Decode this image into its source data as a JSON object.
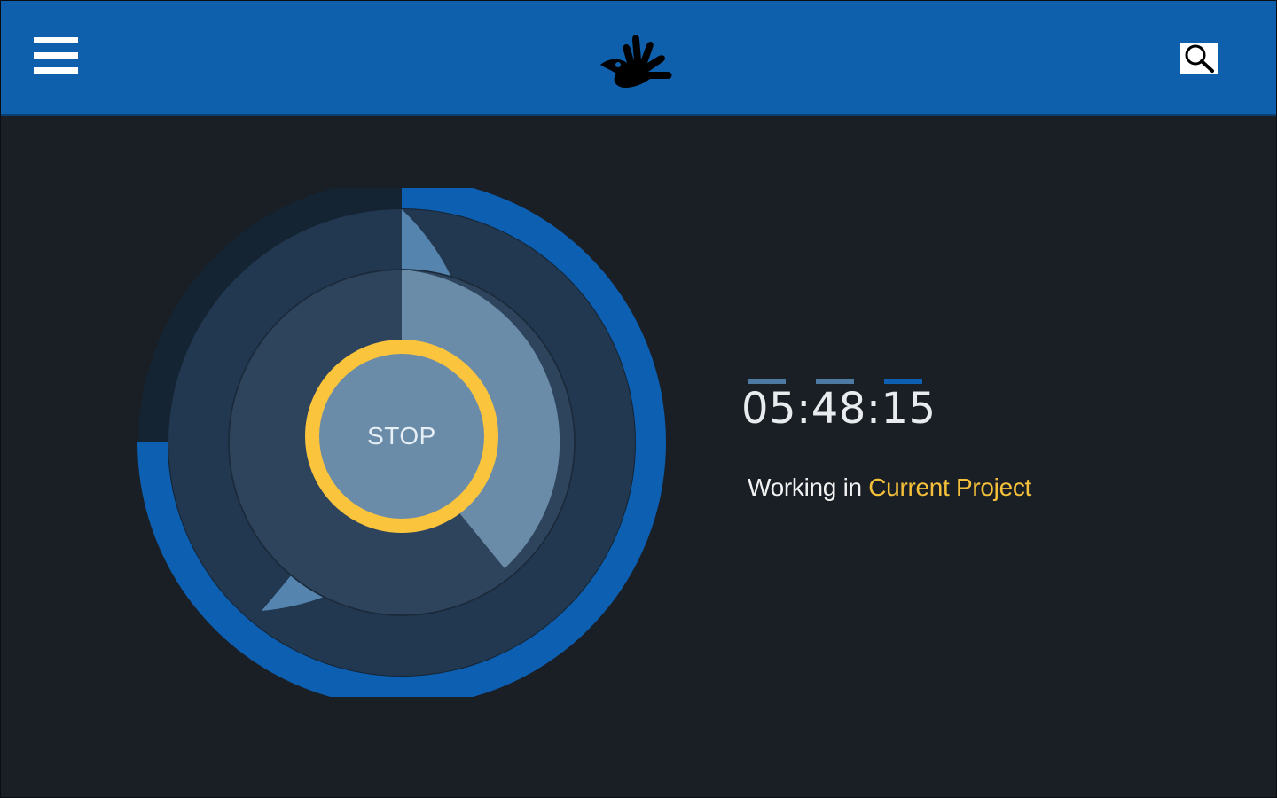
{
  "header": {
    "menu_icon": "hamburger-menu-icon",
    "logo_icon": "accessibility-hand-logo",
    "search_icon": "search-icon",
    "color": "#0e60ad"
  },
  "dial": {
    "button_label": "STOP",
    "ring_color": "#0d5fb1",
    "accent_color": "#fbc43d"
  },
  "timer": {
    "value": "05:48:15",
    "indicator_colors": [
      "#4d7aa3",
      "#4d7aa3",
      "#0d5fb1"
    ]
  },
  "status": {
    "prefix": "Working in",
    "project": "Current Project",
    "project_color": "#f5c03a"
  }
}
